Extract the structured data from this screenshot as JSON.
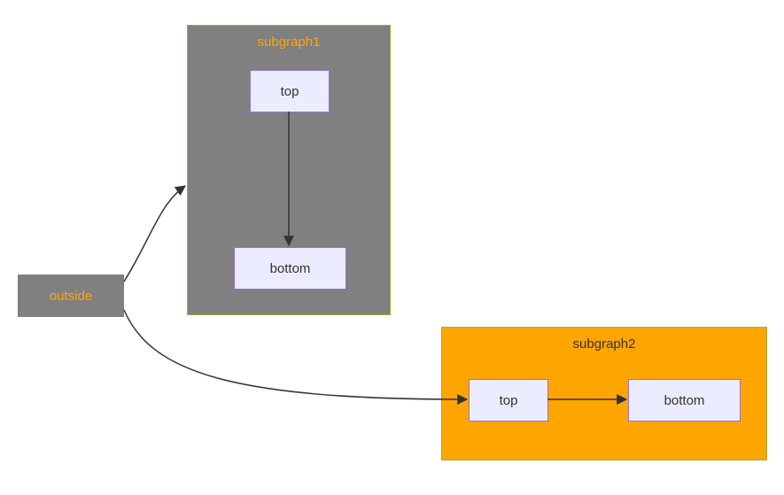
{
  "diagram": {
    "outside": {
      "label": "outside"
    },
    "subgraph1": {
      "title": "subgraph1",
      "nodes": {
        "top": "top",
        "bottom": "bottom"
      }
    },
    "subgraph2": {
      "title": "subgraph2",
      "nodes": {
        "top": "top",
        "bottom": "bottom"
      }
    },
    "edges": [
      {
        "from": "outside",
        "to": "subgraph1"
      },
      {
        "from": "outside",
        "to": "subgraph2.top"
      },
      {
        "from": "subgraph1.top",
        "to": "subgraph1.bottom"
      },
      {
        "from": "subgraph2.top",
        "to": "subgraph2.bottom"
      }
    ],
    "colors": {
      "subgraph1_fill": "#808080",
      "subgraph2_fill": "#FFA500",
      "node_fill": "#ECECFF",
      "node_stroke": "#9370DB",
      "title1_color": "#FFA500",
      "title2_color": "#333333",
      "edge_stroke": "#333333"
    }
  }
}
